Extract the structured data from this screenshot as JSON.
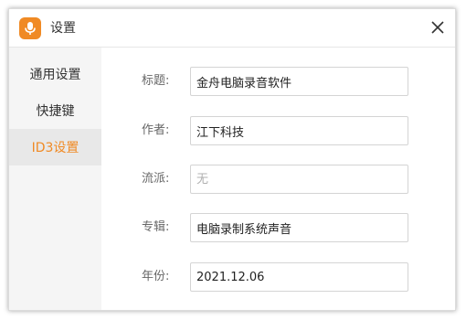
{
  "window": {
    "title": "设置",
    "accent_color": "#f08a24",
    "icons": {
      "app": "microphone-icon",
      "close": "close-icon"
    }
  },
  "sidebar": {
    "items": [
      {
        "label": "通用设置",
        "active": false
      },
      {
        "label": "快捷键",
        "active": false
      },
      {
        "label": "ID3设置",
        "active": true
      }
    ]
  },
  "form": {
    "title": {
      "label": "标题:",
      "value": "金舟电脑录音软件",
      "placeholder": ""
    },
    "author": {
      "label": "作者:",
      "value": "江下科技",
      "placeholder": ""
    },
    "genre": {
      "label": "流派:",
      "value": "",
      "placeholder": "无"
    },
    "album": {
      "label": "专辑:",
      "value": "电脑录制系统声音",
      "placeholder": ""
    },
    "year": {
      "label": "年份:",
      "value": "2021.12.06",
      "placeholder": ""
    }
  }
}
